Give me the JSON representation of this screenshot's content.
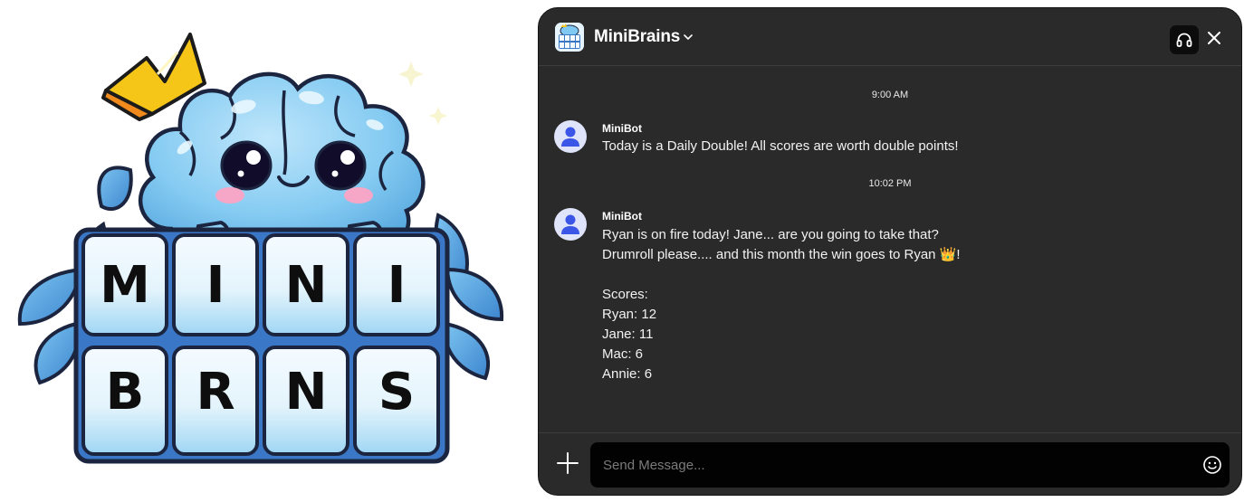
{
  "logo": {
    "tiles_row1": [
      "M",
      "I",
      "N",
      "I"
    ],
    "tiles_row2": [
      "B",
      "R",
      "N",
      "S"
    ]
  },
  "header": {
    "app_name": "MiniBrains",
    "icons": [
      "app-logo-icon",
      "chevron-down-icon",
      "headphones-icon",
      "close-icon"
    ]
  },
  "messages": [
    {
      "time": "9:00 AM",
      "sender": "MiniBot",
      "text": "Today is a Daily Double! All scores are worth double points!"
    },
    {
      "time": "10:02 PM",
      "sender": "MiniBot",
      "text": "Ryan is on fire today! Jane... are you going to take that?\nDrumroll please.... and this month the win goes to Ryan 👑!\n\nScores:\nRyan: 12\nJane: 11\nMac: 6\nAnnie: 6"
    }
  ],
  "composer": {
    "placeholder": "Send Message...",
    "icons": [
      "plus-icon",
      "smiley-icon"
    ]
  },
  "colors": {
    "window_bg": "#2a2a2a",
    "input_bg": "#020202",
    "avatar_bg": "#dfe4fb",
    "avatar_fg": "#3b55e6",
    "brain_blue": "#7fc9f2",
    "crown_gold": "#f5c518"
  }
}
